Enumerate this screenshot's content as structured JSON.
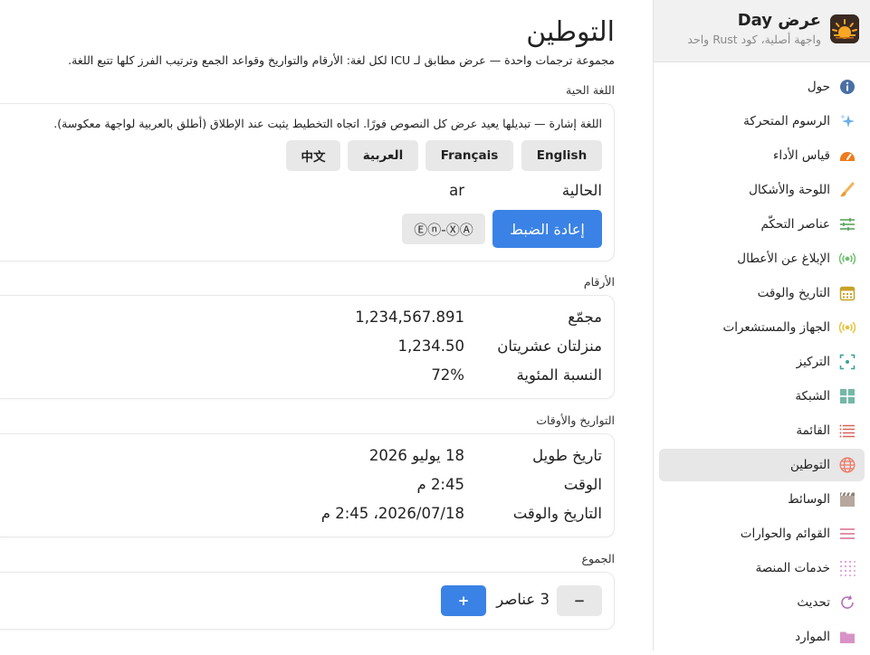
{
  "app": {
    "title": "عرض Day",
    "subtitle": "واجهة أصلية، كود Rust واحد"
  },
  "sidebar": {
    "items": [
      {
        "label": "حول",
        "icon": "info-icon"
      },
      {
        "label": "الرسوم المتحركة",
        "icon": "sparkles-icon"
      },
      {
        "label": "قياس الأداء",
        "icon": "gauge-icon"
      },
      {
        "label": "اللوحة والأشكال",
        "icon": "brush-icon"
      },
      {
        "label": "عناصر التحكّم",
        "icon": "sliders-icon"
      },
      {
        "label": "الإبلاغ عن الأعطال",
        "icon": "broadcast-icon"
      },
      {
        "label": "التاريخ والوقت",
        "icon": "calendar-icon"
      },
      {
        "label": "الجهاز والمستشعرات",
        "icon": "sensor-icon"
      },
      {
        "label": "التركيز",
        "icon": "focus-icon"
      },
      {
        "label": "الشبكة",
        "icon": "grid-icon"
      },
      {
        "label": "القائمة",
        "icon": "list-icon"
      },
      {
        "label": "التوطين",
        "icon": "globe-icon"
      },
      {
        "label": "الوسائط",
        "icon": "clapper-icon"
      },
      {
        "label": "القوائم والحوارات",
        "icon": "menu-icon"
      },
      {
        "label": "خدمات المنصة",
        "icon": "dots-grid-icon"
      },
      {
        "label": "تحديث",
        "icon": "refresh-icon"
      },
      {
        "label": "الموارد",
        "icon": "folder-icon"
      }
    ],
    "active_index": 11
  },
  "main": {
    "title": "التوطين",
    "description": "مجموعة ترجمات واحدة — عرض مطابق لـ ICU لكل لغة: الأرقام والتواريخ وقواعد الجمع وترتيب الفرز كلها تتبع اللغة.",
    "live_language": {
      "section_label": "اللغة الحية",
      "hint": "اللغة إشارة — تبديلها يعيد عرض كل النصوص فورًا. اتجاه التخطيط يثبت عند الإطلاق (أطلق بالعربية لواجهة معكوسة).",
      "languages": [
        "English",
        "Français",
        "العربية",
        "中文"
      ],
      "current_label": "الحالية",
      "current_value": "ar",
      "reset_label": "إعادة الضبط",
      "pseudo_label": "Ⓔⓝ-ⓍⒶ"
    },
    "numbers": {
      "section_label": "الأرقام",
      "rows": [
        {
          "label": "مجمّع",
          "value": "1,234,567.891"
        },
        {
          "label": "منزلتان عشريتان",
          "value": "1,234.50"
        },
        {
          "label": "النسبة المئوية",
          "value": "72%"
        }
      ]
    },
    "dates": {
      "section_label": "التواريخ والأوقات",
      "rows": [
        {
          "label": "تاريخ طويل",
          "value": "18 يوليو 2026"
        },
        {
          "label": "الوقت",
          "value": "2:45 م"
        },
        {
          "label": "التاريخ والوقت",
          "value": "2026/07/18، 2:45 م"
        }
      ]
    },
    "plurals": {
      "section_label": "الجموع",
      "decrement_label": "−",
      "count_text": "3 عناصر",
      "increment_label": "+"
    }
  },
  "colors": {
    "accent": "#3b82e6",
    "active_item_bg": "#e7e7e7",
    "sidebar_header_bg": "#f1f1f1"
  }
}
